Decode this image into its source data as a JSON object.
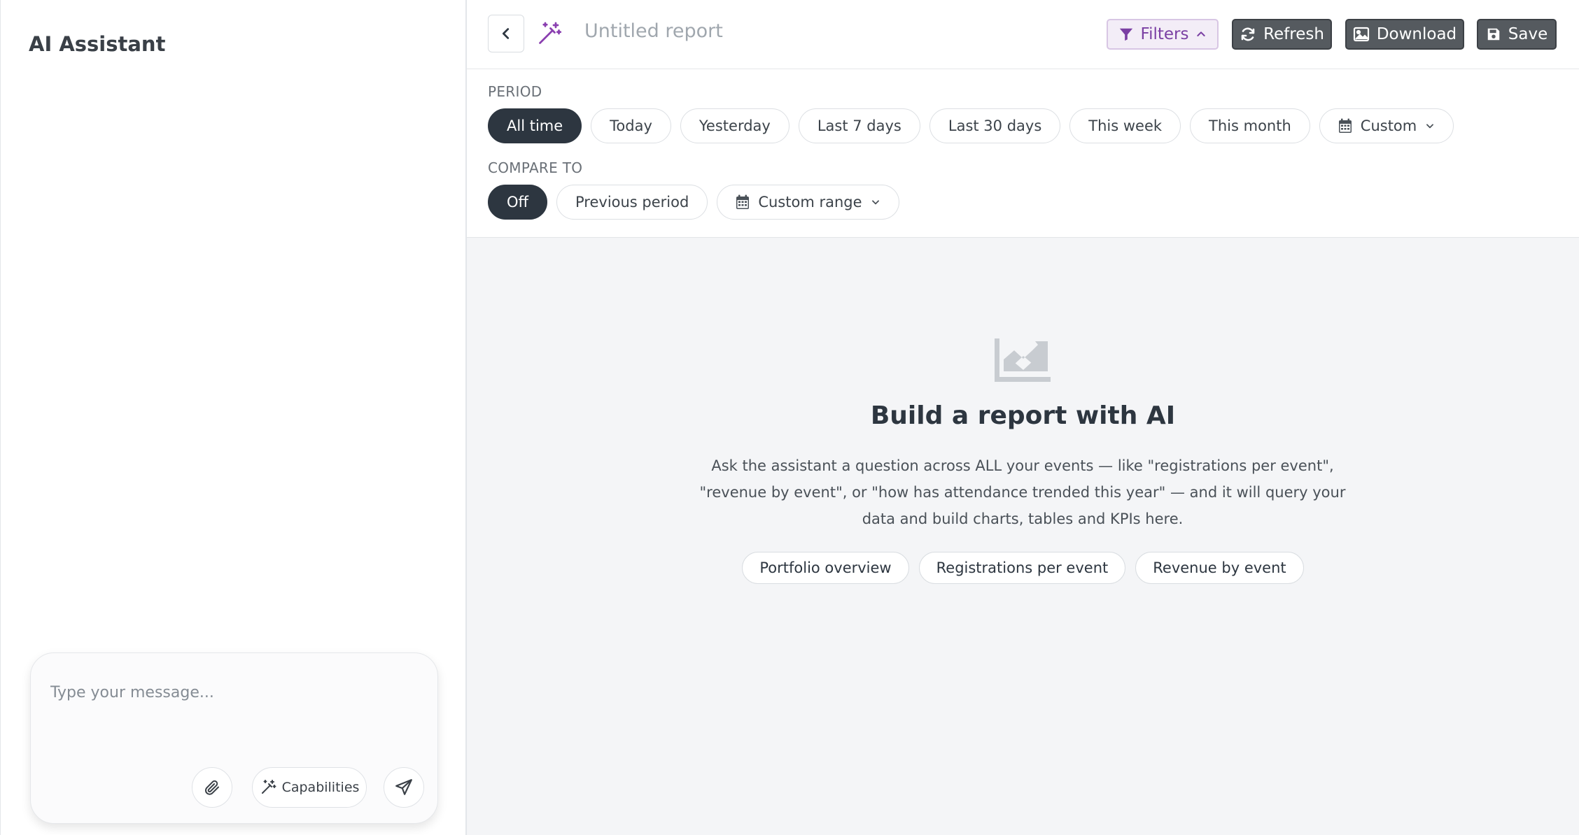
{
  "assistant": {
    "title": "AI Assistant",
    "composer": {
      "placeholder": "Type your message...",
      "capabilities_label": "Capabilities"
    }
  },
  "header": {
    "report_title": "Untitled report",
    "filters_label": "Filters",
    "refresh_label": "Refresh",
    "download_label": "Download",
    "save_label": "Save"
  },
  "filters": {
    "period_label": "PERIOD",
    "period_options": [
      "All time",
      "Today",
      "Yesterday",
      "Last 7 days",
      "Last 30 days",
      "This week",
      "This month"
    ],
    "period_custom_label": "Custom",
    "period_selected": "All time",
    "compare_label": "COMPARE TO",
    "compare_options": [
      "Off",
      "Previous period"
    ],
    "compare_custom_label": "Custom range",
    "compare_selected": "Off"
  },
  "empty_state": {
    "title": "Build a report with AI",
    "description": "Ask the assistant a question across ALL your events — like \"registrations per event\", \"revenue by event\", or \"how has attendance trended this year\" — and it will query your data and build charts, tables and KPIs here.",
    "suggestions": [
      "Portfolio overview",
      "Registrations per event",
      "Revenue by event"
    ]
  },
  "colors": {
    "primary_dark": "#2d3640",
    "filter_accent": "#7a3fa3",
    "button_dark": "#555a5f",
    "background": "#f4f5f7"
  },
  "icons": {
    "back": "chevron-left-icon",
    "ai": "magic-wand-icon",
    "filters": "funnel-icon",
    "refresh": "refresh-icon",
    "download": "image-icon",
    "save": "floppy-disk-icon",
    "calendar": "calendar-icon",
    "empty": "area-chart-icon",
    "attach": "paperclip-icon",
    "send": "paper-plane-icon"
  }
}
